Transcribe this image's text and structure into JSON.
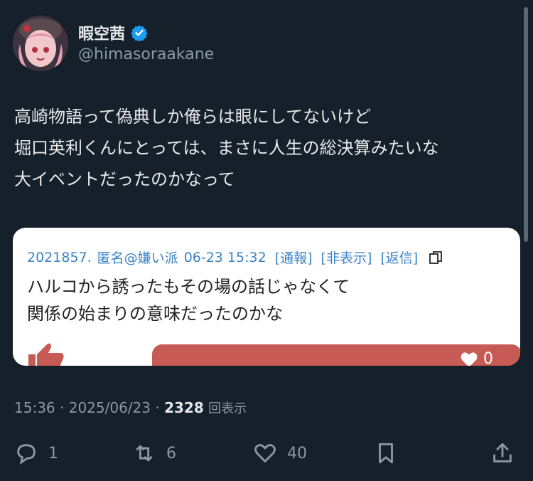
{
  "user": {
    "display_name": "暇空茜",
    "handle": "@himasoraakane"
  },
  "tweet": {
    "lines": [
      "高崎物語って偽典しか俺らは眼にしてないけど",
      "堀口英利くんにとっては、まさに人生の総決算みたいな",
      "大イベントだったのかなって"
    ]
  },
  "quote_card": {
    "post_no": "2021857.",
    "author": "匿名@嫌い派",
    "date": "06-23 15:32",
    "report": "[通報]",
    "hide": "[非表示]",
    "reply": "[返信]",
    "body_lines": [
      "ハルコから誘ったもその場の話じゃなくて",
      "関係の始まりの意味だったのかな"
    ],
    "like_count": "0"
  },
  "meta": {
    "time": "15:36",
    "date": "2025/06/23",
    "views": "2328",
    "views_label": "回表示"
  },
  "actions": {
    "replies": "1",
    "retweets": "6",
    "likes": "40"
  },
  "colors": {
    "background": "#15202b",
    "verified": "#1d9bf0",
    "card_link": "#3b82c6",
    "like_bar": "#c85a55",
    "muted": "#8b98a5"
  }
}
